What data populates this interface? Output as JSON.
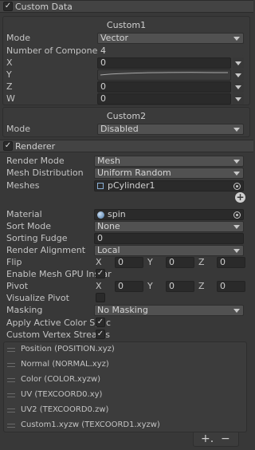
{
  "custom_data": {
    "header": "Custom Data",
    "checked": "✓",
    "custom1": {
      "title": "Custom1",
      "mode_label": "Mode",
      "mode_value": "Vector",
      "components_label": "Number of Components",
      "components_value": "4",
      "x_label": "X",
      "x_value": "0",
      "y_label": "Y",
      "z_label": "Z",
      "z_value": "0",
      "w_label": "W",
      "w_value": "0"
    },
    "custom2": {
      "title": "Custom2",
      "mode_label": "Mode",
      "mode_value": "Disabled"
    }
  },
  "renderer": {
    "header": "Renderer",
    "checked": "✓",
    "render_mode_label": "Render Mode",
    "render_mode_value": "Mesh",
    "mesh_distribution_label": "Mesh Distribution",
    "mesh_distribution_value": "Uniform Random",
    "meshes_label": "Meshes",
    "meshes_value": "pCylinder1",
    "add_glyph": "+",
    "material_label": "Material",
    "material_value": "spin",
    "sort_mode_label": "Sort Mode",
    "sort_mode_value": "None",
    "sorting_fudge_label": "Sorting Fudge",
    "sorting_fudge_value": "0",
    "render_alignment_label": "Render Alignment",
    "render_alignment_value": "Local",
    "flip_label": "Flip",
    "flip": {
      "x_label": "X",
      "x": "0",
      "y_label": "Y",
      "y": "0",
      "z_label": "Z",
      "z": "0"
    },
    "gpu_instancing_label": "Enable Mesh GPU Instar",
    "gpu_instancing_check": "✓",
    "pivot_label": "Pivot",
    "pivot": {
      "x_label": "X",
      "x": "0",
      "y_label": "Y",
      "y": "0",
      "z_label": "Z",
      "z": "0"
    },
    "visualize_pivot_label": "Visualize Pivot",
    "masking_label": "Masking",
    "masking_value": "No Masking",
    "apply_color_space_label": "Apply Active Color Spac",
    "apply_color_space_check": "✓",
    "custom_streams_label": "Custom Vertex Streams",
    "custom_streams_check": "✓",
    "streams": [
      "Position (POSITION.xyz)",
      "Normal (NORMAL.xyz)",
      "Color (COLOR.xyzw)",
      "UV (TEXCOORD0.xy)",
      "UV2 (TEXCOORD0.zw)",
      "Custom1.xyzw (TEXCOORD1.xyzw)"
    ],
    "add_stream": "+.",
    "remove_stream": "−"
  }
}
